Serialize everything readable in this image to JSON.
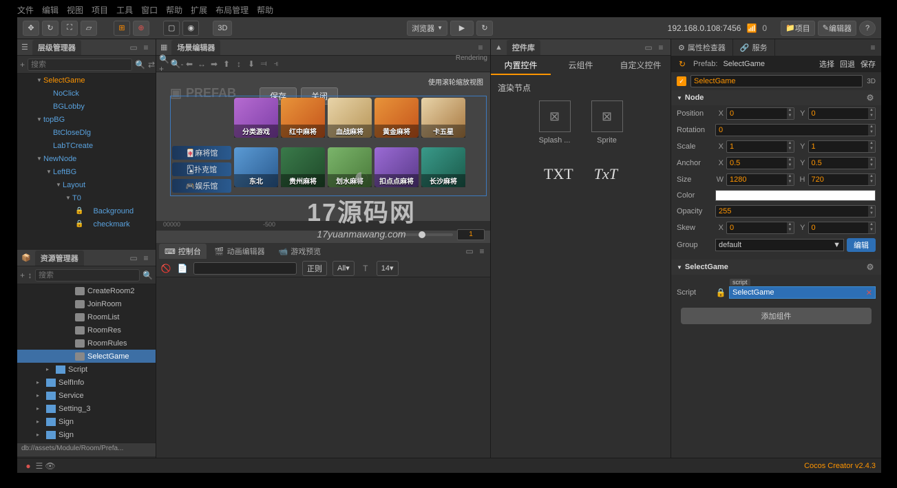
{
  "topmenu": [
    "文件",
    "编辑",
    "视图",
    "项目",
    "工具",
    "窗口",
    "帮助",
    "扩展",
    "布局管理",
    "帮助"
  ],
  "toolbar": {
    "btn3d": "3D",
    "browser": "浏览器",
    "ip": "192.168.0.108:7456",
    "wifi": "0",
    "project": "项目",
    "editor": "编辑器"
  },
  "hierarchy": {
    "title": "层级管理器",
    "search": "搜索",
    "items": [
      {
        "ind": 2,
        "caret": "▼",
        "txt": "SelectGame",
        "sel": true
      },
      {
        "ind": 3,
        "txt": "NoClick"
      },
      {
        "ind": 3,
        "txt": "BGLobby"
      },
      {
        "ind": 2,
        "caret": "▼",
        "txt": "topBG"
      },
      {
        "ind": 3,
        "txt": "BtCloseDlg"
      },
      {
        "ind": 3,
        "txt": "LabTCreate"
      },
      {
        "ind": 2,
        "caret": "▼",
        "txt": "NewNode"
      },
      {
        "ind": 3,
        "caret": "▼",
        "txt": "LeftBG"
      },
      {
        "ind": 4,
        "caret": "▼",
        "txt": "Layout"
      },
      {
        "ind": 5,
        "caret": "▼",
        "txt": "T0"
      },
      {
        "ind": 6,
        "lock": true,
        "txt": "Background"
      },
      {
        "ind": 6,
        "lock": true,
        "txt": "checkmark"
      }
    ]
  },
  "assets": {
    "title": "资源管理器",
    "search": "搜索",
    "items": [
      {
        "ind": 5,
        "type": "pf",
        "txt": "CreateRoom2"
      },
      {
        "ind": 5,
        "type": "pf",
        "txt": "JoinRoom"
      },
      {
        "ind": 5,
        "type": "pf",
        "txt": "RoomList"
      },
      {
        "ind": 5,
        "type": "pf",
        "txt": "RoomRes"
      },
      {
        "ind": 5,
        "type": "pf",
        "txt": "RoomRules"
      },
      {
        "ind": 5,
        "type": "pf",
        "txt": "SelectGame",
        "sel": true
      },
      {
        "ind": 3,
        "caret": "▸",
        "type": "folder",
        "txt": "Script"
      },
      {
        "ind": 2,
        "caret": "▸",
        "type": "folder",
        "txt": "SelfInfo"
      },
      {
        "ind": 2,
        "caret": "▸",
        "type": "folder",
        "txt": "Service"
      },
      {
        "ind": 2,
        "caret": "▸",
        "type": "folder",
        "txt": "Setting_3"
      },
      {
        "ind": 2,
        "caret": "▸",
        "type": "folder",
        "txt": "Sign"
      },
      {
        "ind": 2,
        "caret": "▸",
        "type": "folder",
        "txt": "Sign"
      }
    ],
    "path": "db://assets/Module/Room/Prefa..."
  },
  "scene": {
    "title": "场景编辑器",
    "rendering": "Rendering",
    "prefab": "PREFAB",
    "save": "保存",
    "close": "关闭",
    "ruler": [
      "00000",
      "-500"
    ],
    "side": [
      "麻将馆",
      "扑克馆",
      "娱乐馆"
    ],
    "tiles": [
      {
        "c": "c1",
        "lbl": "分类游戏"
      },
      {
        "c": "c2",
        "lbl": "红中麻将"
      },
      {
        "c": "c3",
        "lbl": "血战麻将"
      },
      {
        "c": "c4",
        "lbl": "黄金麻将"
      },
      {
        "c": "c5",
        "lbl": "卡五星"
      },
      {
        "c": "c6",
        "lbl": "东北"
      },
      {
        "c": "c7",
        "lbl": "贵州麻将"
      },
      {
        "c": "c8",
        "lbl": "划水麻将"
      },
      {
        "c": "c9",
        "lbl": "扣点点麻将"
      },
      {
        "c": "c10",
        "lbl": "长沙麻将"
      }
    ],
    "sliderval": "1",
    "hint": "使用滚轮缩放视图"
  },
  "widgets": {
    "title": "控件库",
    "t1": "内置控件",
    "t2": "云组件",
    "t3": "自定义控件",
    "heading": "渲染节点",
    "i1": "Splash ...",
    "i2": "Sprite",
    "txt1": "TXT",
    "txt2": "TxT"
  },
  "inspector": {
    "title": "属性检查器",
    "services": "服务",
    "prefabLbl": "Prefab:",
    "prefabName": "SelectGame",
    "select": "选择",
    "revert": "回退",
    "save": "保存",
    "nodeName": "SelectGame",
    "dd": "3D",
    "sections": {
      "node": "Node",
      "comp": "SelectGame"
    },
    "rows": {
      "position": "Position",
      "rotation": "Rotation",
      "scale": "Scale",
      "anchor": "Anchor",
      "size": "Size",
      "color": "Color",
      "opacity": "Opacity",
      "skew": "Skew",
      "group": "Group",
      "script": "Script"
    },
    "vals": {
      "px": "0",
      "py": "0",
      "rot": "0",
      "sx": "1",
      "sy": "1",
      "ax": "0.5",
      "ay": "0.5",
      "sw": "1280",
      "sh": "720",
      "op": "255",
      "skx": "0",
      "sky": "0",
      "group": "default",
      "script": "SelectGame",
      "scripttag": "script"
    },
    "axis": {
      "x": "X",
      "y": "Y",
      "w": "W",
      "h": "H"
    },
    "edit": "编辑",
    "addcomp": "添加组件"
  },
  "bottom": {
    "t1": "控制台",
    "t2": "动画编辑器",
    "t3": "游戏预览",
    "filter": "正则",
    "all": "All",
    "fontsize": "14"
  },
  "status": {
    "version": "Cocos Creator v2.4.3"
  },
  "watermark": {
    "big": "17源码网",
    "sm": "17yuanmawang.com"
  }
}
